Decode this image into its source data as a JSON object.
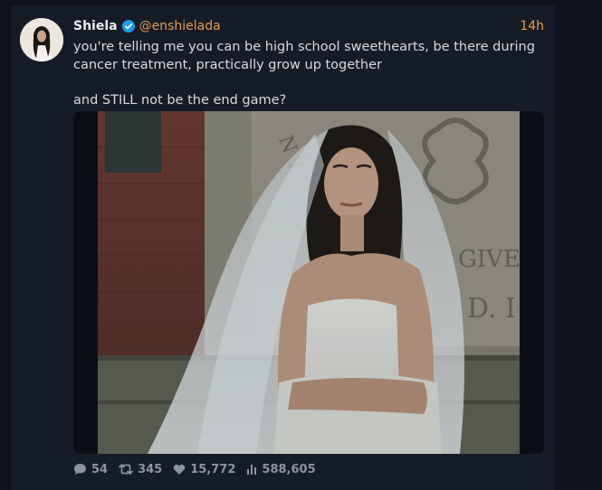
{
  "tweet": {
    "author": {
      "display_name": "Shiela",
      "handle": "@enshielada",
      "verified": true
    },
    "time": "14h",
    "text_line1": "you're telling me you can be high school sweethearts, be there during cancer treatment, practically grow up together",
    "text_line2": "and STILL not be the end game?",
    "media_carved_text": [
      "N T",
      "GIVE",
      "D. I"
    ],
    "stats": {
      "replies": "54",
      "retweets": "345",
      "likes": "15,772",
      "views": "588,605"
    }
  },
  "colors": {
    "accent": "#e39b4f",
    "verified": "#1d9bf0",
    "background": "#161c27"
  }
}
